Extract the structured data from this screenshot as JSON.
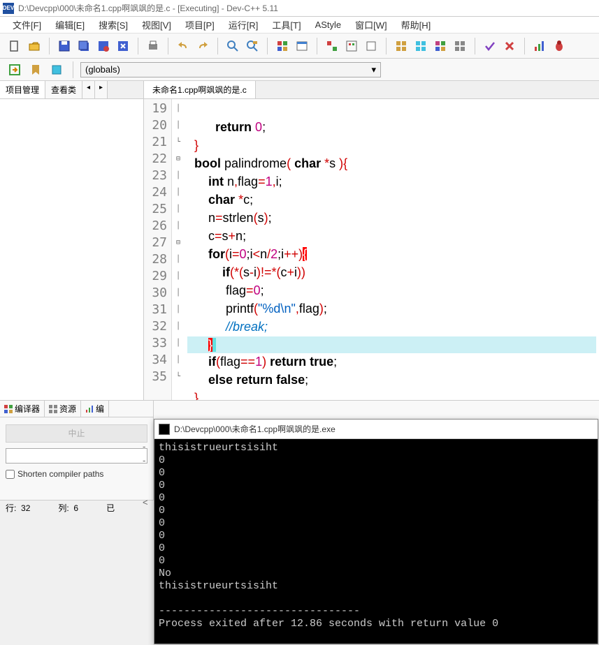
{
  "titlebar": {
    "text": "D:\\Devcpp\\000\\未命名1.cpp啊飒飒的是.c - [Executing] - Dev-C++ 5.11"
  },
  "menu": {
    "items": [
      "文件[F]",
      "编辑[E]",
      "搜索[S]",
      "视图[V]",
      "项目[P]",
      "运行[R]",
      "工具[T]",
      "AStyle",
      "窗口[W]",
      "帮助[H]"
    ]
  },
  "secondbar": {
    "globals": "(globals)"
  },
  "leftpanel": {
    "tabs": [
      "项目管理",
      "查看类"
    ]
  },
  "filetabs": {
    "items": [
      "未命名1.cpp啊飒飒的是.c"
    ]
  },
  "gutter": {
    "start": 19,
    "end": 35
  },
  "code": {
    "lines": [
      {
        "n": 19,
        "raw": ""
      },
      {
        "n": 20,
        "raw": "        return 0;",
        "tokens": [
          {
            "t": "        ",
            "c": ""
          },
          {
            "t": "return",
            "c": "kw"
          },
          {
            "t": " ",
            "c": ""
          },
          {
            "t": "0",
            "c": "num"
          },
          {
            "t": ";",
            "c": ""
          }
        ]
      },
      {
        "n": 21,
        "raw": "  }",
        "tokens": [
          {
            "t": "  ",
            "c": ""
          },
          {
            "t": "}",
            "c": "op"
          }
        ],
        "fold": "└"
      },
      {
        "n": 22,
        "raw": "  bool palindrome( char *s ){",
        "tokens": [
          {
            "t": "  ",
            "c": ""
          },
          {
            "t": "bool",
            "c": "ty"
          },
          {
            "t": " palindrome",
            "c": ""
          },
          {
            "t": "(",
            "c": "op"
          },
          {
            "t": " ",
            "c": ""
          },
          {
            "t": "char",
            "c": "ty"
          },
          {
            "t": " ",
            "c": ""
          },
          {
            "t": "*",
            "c": "op"
          },
          {
            "t": "s ",
            "c": ""
          },
          {
            "t": ")",
            "c": "op"
          },
          {
            "t": "{",
            "c": "op"
          }
        ],
        "fold": "⊟"
      },
      {
        "n": 23,
        "raw": "      int n,flag=1,i;",
        "tokens": [
          {
            "t": "      ",
            "c": ""
          },
          {
            "t": "int",
            "c": "ty"
          },
          {
            "t": " n",
            "c": ""
          },
          {
            "t": ",",
            "c": "op"
          },
          {
            "t": "flag",
            "c": ""
          },
          {
            "t": "=",
            "c": "op"
          },
          {
            "t": "1",
            "c": "num"
          },
          {
            "t": ",",
            "c": "op"
          },
          {
            "t": "i",
            "c": ""
          },
          {
            "t": ";",
            "c": ""
          }
        ]
      },
      {
        "n": 24,
        "raw": "      char *c;",
        "tokens": [
          {
            "t": "      ",
            "c": ""
          },
          {
            "t": "char",
            "c": "ty"
          },
          {
            "t": " ",
            "c": ""
          },
          {
            "t": "*",
            "c": "op"
          },
          {
            "t": "c",
            "c": ""
          },
          {
            "t": ";",
            "c": ""
          }
        ]
      },
      {
        "n": 25,
        "raw": "      n=strlen(s);",
        "tokens": [
          {
            "t": "      n",
            "c": ""
          },
          {
            "t": "=",
            "c": "op"
          },
          {
            "t": "strlen",
            "c": ""
          },
          {
            "t": "(",
            "c": "op"
          },
          {
            "t": "s",
            "c": ""
          },
          {
            "t": ")",
            "c": "op"
          },
          {
            "t": ";",
            "c": ""
          }
        ]
      },
      {
        "n": 26,
        "raw": "      c=s+n;",
        "tokens": [
          {
            "t": "      c",
            "c": ""
          },
          {
            "t": "=",
            "c": "op"
          },
          {
            "t": "s",
            "c": ""
          },
          {
            "t": "+",
            "c": "op"
          },
          {
            "t": "n",
            "c": ""
          },
          {
            "t": ";",
            "c": ""
          }
        ]
      },
      {
        "n": 27,
        "raw": "      for(i=0;i<n/2;i++){",
        "tokens": [
          {
            "t": "      ",
            "c": ""
          },
          {
            "t": "for",
            "c": "kw"
          },
          {
            "t": "(",
            "c": "op"
          },
          {
            "t": "i",
            "c": ""
          },
          {
            "t": "=",
            "c": "op"
          },
          {
            "t": "0",
            "c": "num"
          },
          {
            "t": ";",
            "c": ""
          },
          {
            "t": "i",
            "c": ""
          },
          {
            "t": "<",
            "c": "op"
          },
          {
            "t": "n",
            "c": ""
          },
          {
            "t": "/",
            "c": "op"
          },
          {
            "t": "2",
            "c": "num"
          },
          {
            "t": ";",
            "c": ""
          },
          {
            "t": "i",
            "c": ""
          },
          {
            "t": "++",
            "c": "op"
          },
          {
            "t": ")",
            "c": "op"
          },
          {
            "t": "{",
            "c": "br-hl"
          }
        ],
        "fold": "⊟"
      },
      {
        "n": 28,
        "raw": "          if(*(s-i)!=*(c+i))",
        "tokens": [
          {
            "t": "          ",
            "c": ""
          },
          {
            "t": "if",
            "c": "kw"
          },
          {
            "t": "(*(",
            "c": "op"
          },
          {
            "t": "s",
            "c": ""
          },
          {
            "t": "-",
            "c": "op"
          },
          {
            "t": "i",
            "c": ""
          },
          {
            "t": ")!=*(",
            "c": "op"
          },
          {
            "t": "c",
            "c": ""
          },
          {
            "t": "+",
            "c": "op"
          },
          {
            "t": "i",
            "c": ""
          },
          {
            "t": "))",
            "c": "op"
          }
        ]
      },
      {
        "n": 29,
        "raw": "           flag=0;",
        "tokens": [
          {
            "t": "           flag",
            "c": ""
          },
          {
            "t": "=",
            "c": "op"
          },
          {
            "t": "0",
            "c": "num"
          },
          {
            "t": ";",
            "c": ""
          }
        ]
      },
      {
        "n": 30,
        "raw": "           printf(\"%d\\n\",flag);",
        "tokens": [
          {
            "t": "           printf",
            "c": ""
          },
          {
            "t": "(",
            "c": "op"
          },
          {
            "t": "\"%d\\n\"",
            "c": "str"
          },
          {
            "t": ",",
            "c": "op"
          },
          {
            "t": "flag",
            "c": ""
          },
          {
            "t": ")",
            "c": "op"
          },
          {
            "t": ";",
            "c": ""
          }
        ]
      },
      {
        "n": 31,
        "raw": "           //break;",
        "tokens": [
          {
            "t": "           ",
            "c": ""
          },
          {
            "t": "//break;",
            "c": "cmt"
          }
        ]
      },
      {
        "n": 32,
        "raw": "      }",
        "tokens": [
          {
            "t": "      ",
            "c": ""
          },
          {
            "t": "}",
            "c": "br-hl"
          },
          {
            "t": " ",
            "c": "br-cy"
          }
        ],
        "hl": true
      },
      {
        "n": 33,
        "raw": "      if(flag==1) return true;",
        "tokens": [
          {
            "t": "      ",
            "c": ""
          },
          {
            "t": "if",
            "c": "kw"
          },
          {
            "t": "(",
            "c": "op"
          },
          {
            "t": "flag",
            "c": ""
          },
          {
            "t": "==",
            "c": "op"
          },
          {
            "t": "1",
            "c": "num"
          },
          {
            "t": ")",
            "c": "op"
          },
          {
            "t": " ",
            "c": ""
          },
          {
            "t": "return",
            "c": "kw"
          },
          {
            "t": " ",
            "c": ""
          },
          {
            "t": "true",
            "c": "kw"
          },
          {
            "t": ";",
            "c": ""
          }
        ]
      },
      {
        "n": 34,
        "raw": "      else return false;",
        "tokens": [
          {
            "t": "      ",
            "c": ""
          },
          {
            "t": "else",
            "c": "kw"
          },
          {
            "t": " ",
            "c": ""
          },
          {
            "t": "return",
            "c": "kw"
          },
          {
            "t": " ",
            "c": ""
          },
          {
            "t": "false",
            "c": "kw"
          },
          {
            "t": ";",
            "c": ""
          }
        ]
      },
      {
        "n": 35,
        "raw": "  }",
        "tokens": [
          {
            "t": "  ",
            "c": ""
          },
          {
            "t": "}",
            "c": "op"
          }
        ],
        "fold": "└"
      }
    ]
  },
  "bottompanel": {
    "tabs": [
      "编译器",
      "资源",
      "编"
    ],
    "stop_btn": "中止",
    "checkbox": "Shorten compiler paths"
  },
  "statusbar": {
    "line_lbl": "行:",
    "line_val": "32",
    "col_lbl": "列:",
    "col_val": "6",
    "extra": "已"
  },
  "console": {
    "title": "D:\\Devcpp\\000\\未命名1.cpp啊飒飒的是.exe",
    "lines": [
      "thisistrueurtsisiht",
      "0",
      "0",
      "0",
      "0",
      "0",
      "0",
      "0",
      "0",
      "0",
      "No",
      "thisistrueurtsisiht",
      "",
      "--------------------------------",
      "Process exited after 12.86 seconds with return value 0"
    ]
  }
}
